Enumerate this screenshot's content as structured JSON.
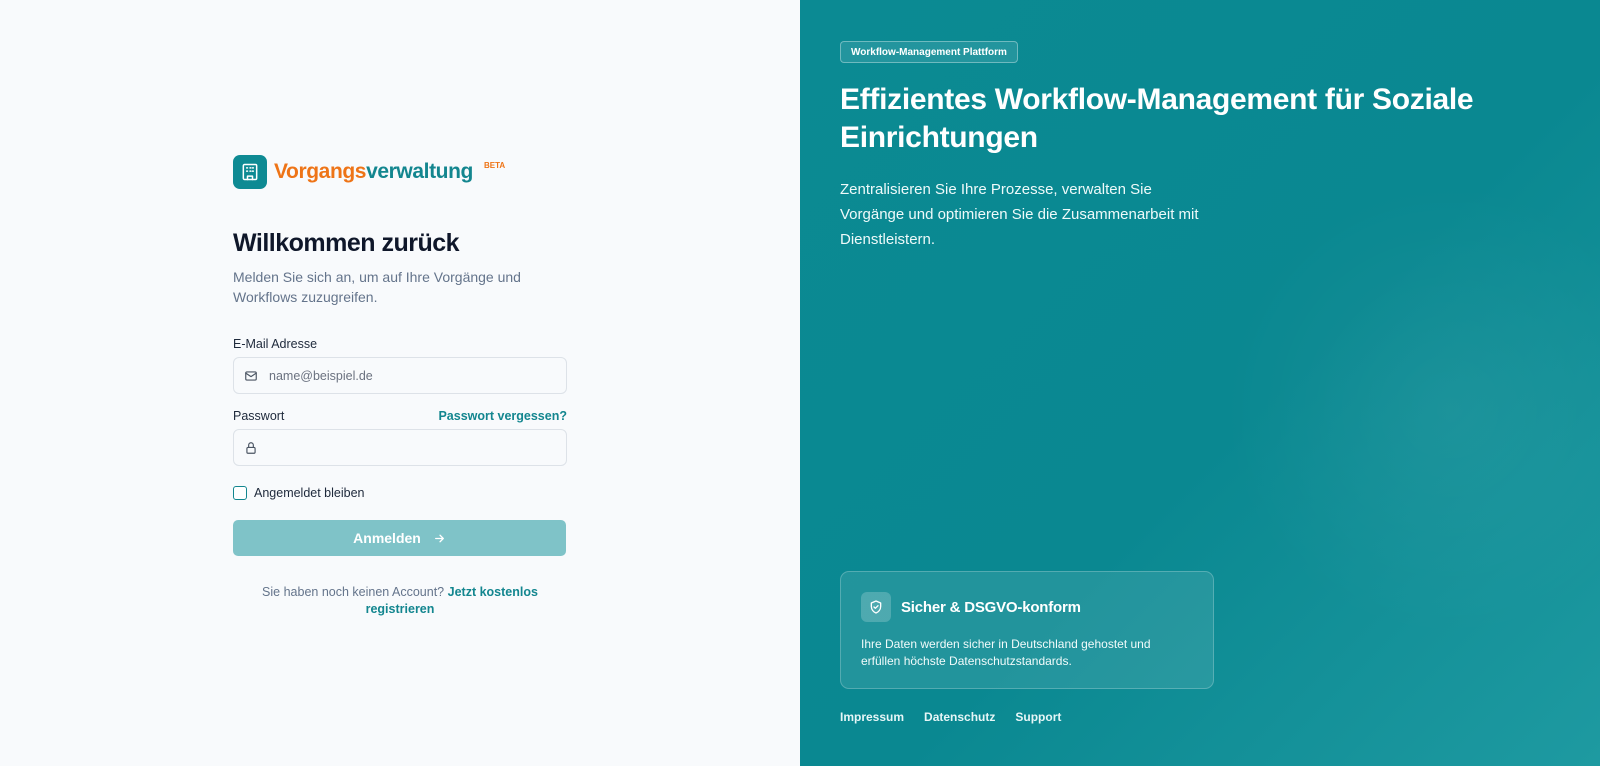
{
  "brand": {
    "name_part1": "Vorgangs",
    "name_part2": "verwaltung",
    "beta": "BETA",
    "logo_icon": "building-icon"
  },
  "login": {
    "title": "Willkommen zurück",
    "subtitle": "Melden Sie sich an, um auf Ihre Vorgänge und Workflows zuzugreifen.",
    "email_label": "E-Mail Adresse",
    "email_placeholder": "name@beispiel.de",
    "email_value": "",
    "password_label": "Passwort",
    "password_value": "",
    "forgot_link": "Passwort vergessen?",
    "remember_label": "Angemeldet bleiben",
    "remember_checked": false,
    "submit_label": "Anmelden",
    "register_prompt": "Sie haben noch keinen Account?",
    "register_link": "Jetzt kostenlos registrieren"
  },
  "promo": {
    "badge": "Workflow-Management Plattform",
    "headline": "Effizientes Workflow-Management für Soziale Einrichtungen",
    "intro": "Zentralisieren Sie Ihre Prozesse, verwalten Sie Vorgänge und optimieren Sie die Zusammenarbeit mit Dienstleistern.",
    "card_title": "Sicher & DSGVO-konform",
    "card_text": "Ihre Daten werden sicher in Deutschland gehostet und erfüllen höchste Datenschutzstandards.",
    "card_icon": "shield-check-icon"
  },
  "footer": {
    "links": [
      "Impressum",
      "Datenschutz",
      "Support"
    ]
  },
  "colors": {
    "accent_teal": "#0e8a93",
    "brand_orange": "#ee7417",
    "button_disabled": "#7fc3c8"
  }
}
